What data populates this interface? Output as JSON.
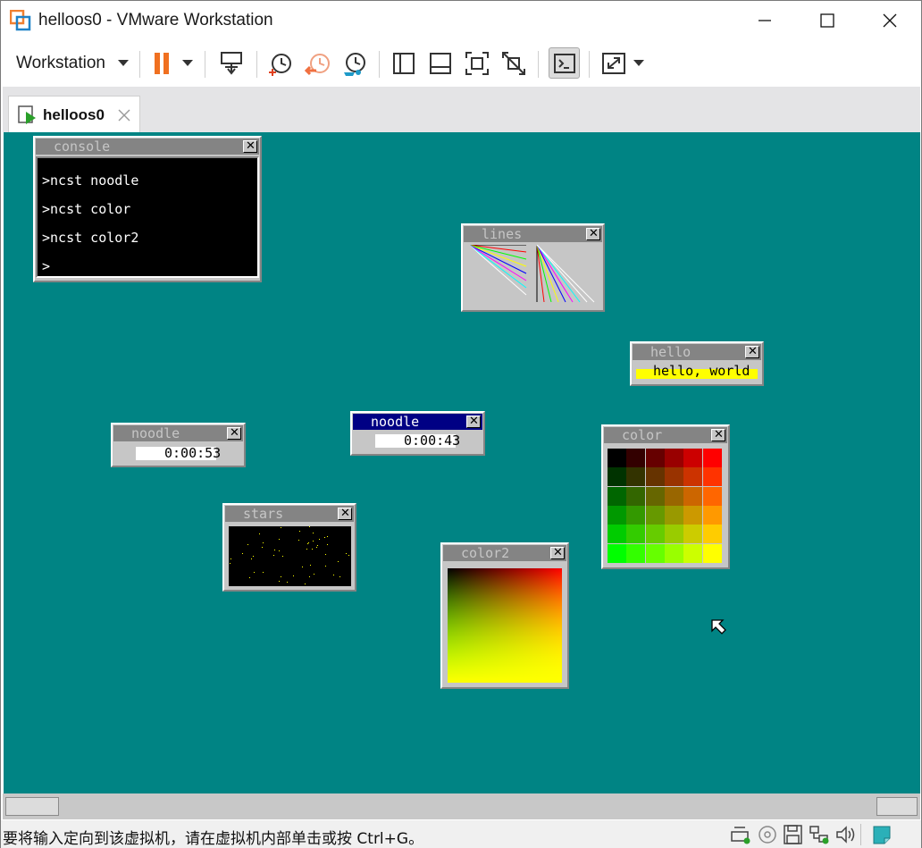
{
  "window": {
    "title": "helloos0 - VMware Workstation",
    "icon": "vmware-icon",
    "controls": [
      "minimize-icon",
      "maximize-icon",
      "close-icon"
    ]
  },
  "toolbar": {
    "menu_label": "Workstation",
    "icons": [
      "pause-icon",
      "send-ctrl-alt-del-icon",
      "snapshot-take-icon",
      "snapshot-revert-icon",
      "snapshot-manager-icon",
      "library-view-icon",
      "thumbnail-bar-icon",
      "full-screen-icon",
      "unity-icon",
      "console-view-icon",
      "stretch-guest-icon"
    ],
    "accent": "#f07020"
  },
  "tab": {
    "label": "helloos0",
    "icon": "vm-play-icon"
  },
  "guest": {
    "desktop_color": "#008484",
    "windows": {
      "console": {
        "title": "console",
        "lines": [
          ">ncst noodle",
          ">ncst color",
          ">ncst color2",
          ">"
        ]
      },
      "lines": {
        "title": "lines"
      },
      "hello": {
        "title": "hello",
        "text": "hello, world"
      },
      "noodle_a": {
        "title": "noodle",
        "time": "0:00:53"
      },
      "noodle_b": {
        "title": "noodle",
        "time": "0:00:43"
      },
      "color": {
        "title": "color"
      },
      "stars": {
        "title": "stars"
      },
      "color2": {
        "title": "color2"
      }
    },
    "close_glyph": "✕"
  },
  "status": {
    "text": "要将输入定向到该虚拟机，请在虚拟机内部单击或按 Ctrl+G。",
    "icons": [
      "hard-disk-icon",
      "cd-rom-icon",
      "floppy-icon",
      "network-icon",
      "sound-icon",
      "message-icon"
    ]
  }
}
